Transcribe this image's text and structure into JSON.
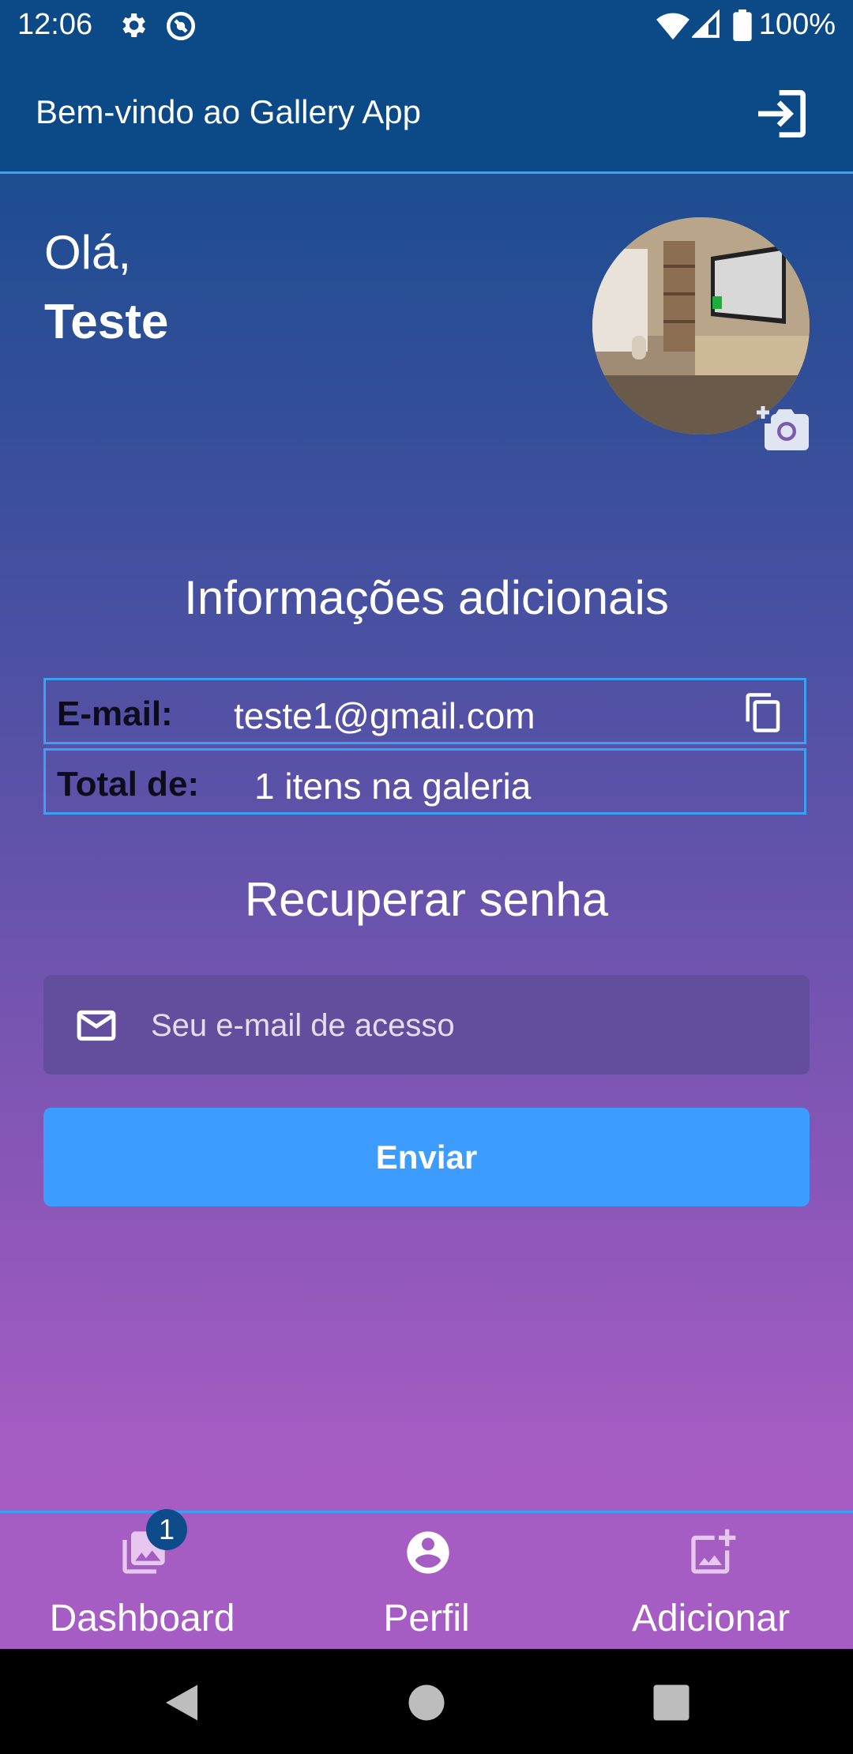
{
  "status_bar": {
    "time": "12:06",
    "battery": "100%",
    "icons": [
      "gear-icon",
      "sync-icon",
      "wifi-icon",
      "signal-icon",
      "battery-icon"
    ]
  },
  "app_bar": {
    "title": "Bem-vindo ao Gallery App",
    "action_icon": "logout-icon"
  },
  "profile": {
    "greeting": "Olá,",
    "name": "Teste"
  },
  "info": {
    "title": "Informações adicionais",
    "email_label": "E-mail:",
    "email_value": "teste1@gmail.com",
    "total_label": "Total de:",
    "total_value": "1 itens na galeria"
  },
  "recover": {
    "title": "Recuperar senha",
    "placeholder": "Seu e-mail de acesso",
    "value": "",
    "button": "Enviar"
  },
  "bottom_nav": {
    "items": [
      {
        "label": "Dashboard",
        "icon": "gallery-icon",
        "badge": "1"
      },
      {
        "label": "Perfil",
        "icon": "account-circle-icon"
      },
      {
        "label": "Adicionar",
        "icon": "add-photo-icon"
      }
    ]
  },
  "colors": {
    "header": "#0b4a87",
    "accent": "#3aa0f3",
    "button": "#3d9cff",
    "gradient_end": "#a85cc4"
  }
}
